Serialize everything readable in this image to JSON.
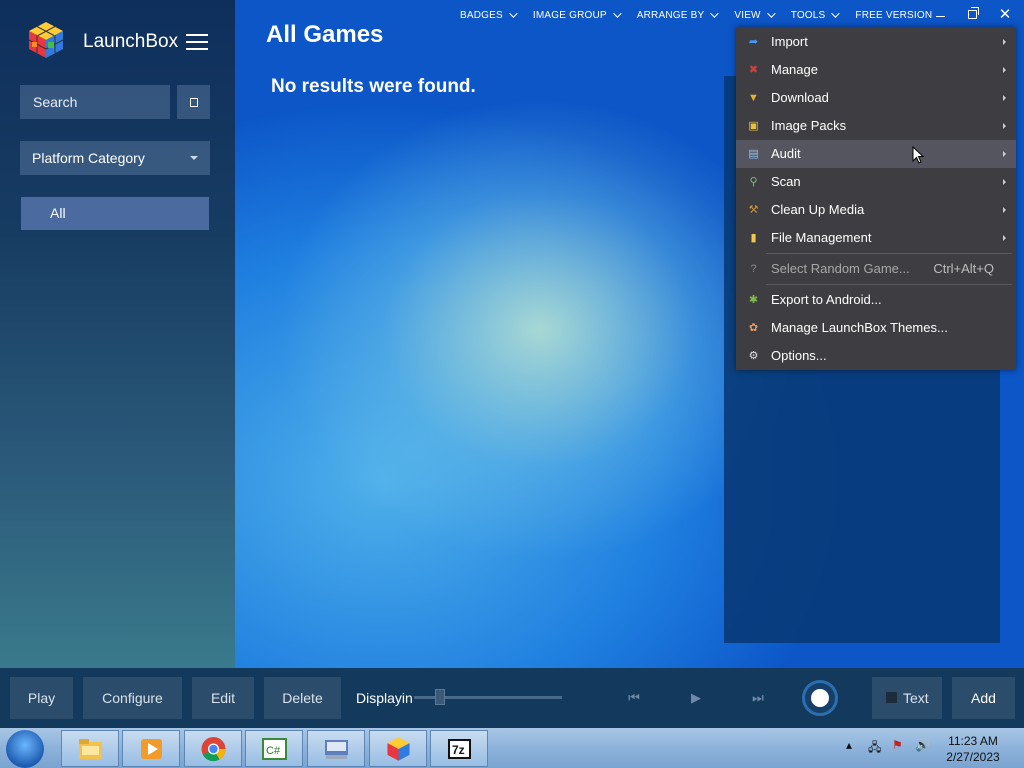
{
  "app": {
    "name": "LaunchBox"
  },
  "sidebar": {
    "search_placeholder": "Search",
    "category_label": "Platform Category",
    "items": [
      {
        "label": "All",
        "selected": true
      }
    ]
  },
  "main": {
    "title": "All Games",
    "empty_message": "No results were found."
  },
  "topmenu": [
    {
      "label": "BADGES",
      "dropdown": true
    },
    {
      "label": "IMAGE GROUP",
      "dropdown": true
    },
    {
      "label": "ARRANGE BY",
      "dropdown": true
    },
    {
      "label": "VIEW",
      "dropdown": true
    },
    {
      "label": "TOOLS",
      "dropdown": true
    },
    {
      "label": "FREE VERSION",
      "dropdown": false
    }
  ],
  "tools_menu": [
    {
      "label": "Import",
      "icon": "import-arrow-icon",
      "submenu": true
    },
    {
      "label": "Manage",
      "icon": "tools-icon",
      "submenu": true
    },
    {
      "label": "Download",
      "icon": "download-icon",
      "submenu": true
    },
    {
      "label": "Image Packs",
      "icon": "image-packs-icon",
      "submenu": true
    },
    {
      "label": "Audit",
      "icon": "audit-icon",
      "submenu": true,
      "hover": true
    },
    {
      "label": "Scan",
      "icon": "scan-magnifier-icon",
      "submenu": true
    },
    {
      "label": "Clean Up Media",
      "icon": "broom-icon",
      "submenu": true
    },
    {
      "label": "File Management",
      "icon": "folder-icon",
      "submenu": true
    },
    {
      "label": "Select Random Game...",
      "icon": "help-icon",
      "shortcut": "Ctrl+Alt+Q",
      "disabled": true
    },
    {
      "label": "Export to Android...",
      "icon": "android-icon"
    },
    {
      "label": "Manage LaunchBox Themes...",
      "icon": "palette-icon"
    },
    {
      "label": "Options...",
      "icon": "gear-icon"
    }
  ],
  "bottombar": {
    "play": "Play",
    "configure": "Configure",
    "edit": "Edit",
    "delete": "Delete",
    "display_label": "Displayin",
    "text_toggle": "Text",
    "add": "Add"
  },
  "taskbar": {
    "time": "11:23 AM",
    "date": "2/27/2023"
  },
  "colors": {
    "menu_bg": "#3e3e42",
    "menu_hover": "#555560",
    "sidebar_selected": "#4a6aa0",
    "bottom_bar": "#133a5c"
  }
}
